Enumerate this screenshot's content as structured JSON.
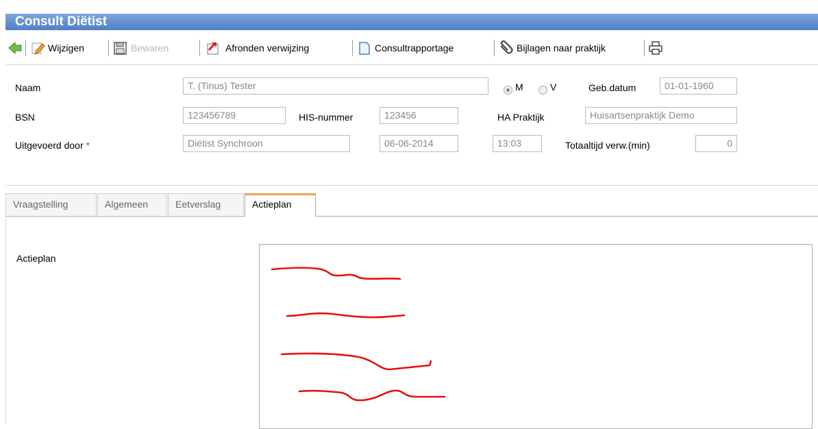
{
  "window": {
    "title": "Consult Diëtist"
  },
  "toolbar": {
    "back_icon": "back-arrow-icon",
    "edit_label": "Wijzigen",
    "save_label": "Bewaren",
    "finish_label": "Afronden verwijzing",
    "report_label": "Consultrapportage",
    "attach_label": "Bijlagen naar praktijk",
    "print_icon": "printer-icon"
  },
  "form": {
    "name_label": "Naam",
    "name_value": "T. (Tinus) Tester",
    "gender_m": "M",
    "gender_v": "V",
    "gender_selected": "M",
    "dob_label": "Geb.datum",
    "dob_value": "01-01-1960",
    "bsn_label": "BSN",
    "bsn_value": "123456789",
    "his_label": "HIS-nummer",
    "his_value": "123456",
    "ha_label": "HA Praktijk",
    "ha_value": "Huisartsenpraktijk Demo",
    "by_label": "Uitgevoerd door",
    "required_mark": "*",
    "by_value": "Diëtist Synchroon",
    "date_value": "06-06-2014",
    "time_value": "13:03",
    "total_label": "Totaaltijd verw.(min)",
    "total_value": "0"
  },
  "tabs": [
    {
      "label": "Vraagstelling"
    },
    {
      "label": "Algemeen"
    },
    {
      "label": "Eetverslag"
    },
    {
      "label": "Actieplan"
    }
  ],
  "active_tab": "Actieplan",
  "main": {
    "actieplan_label": "Actieplan"
  },
  "colors": {
    "title_bar": "#5b88cf",
    "scribble": "#e81010",
    "tab_accent": "#f0a050"
  }
}
